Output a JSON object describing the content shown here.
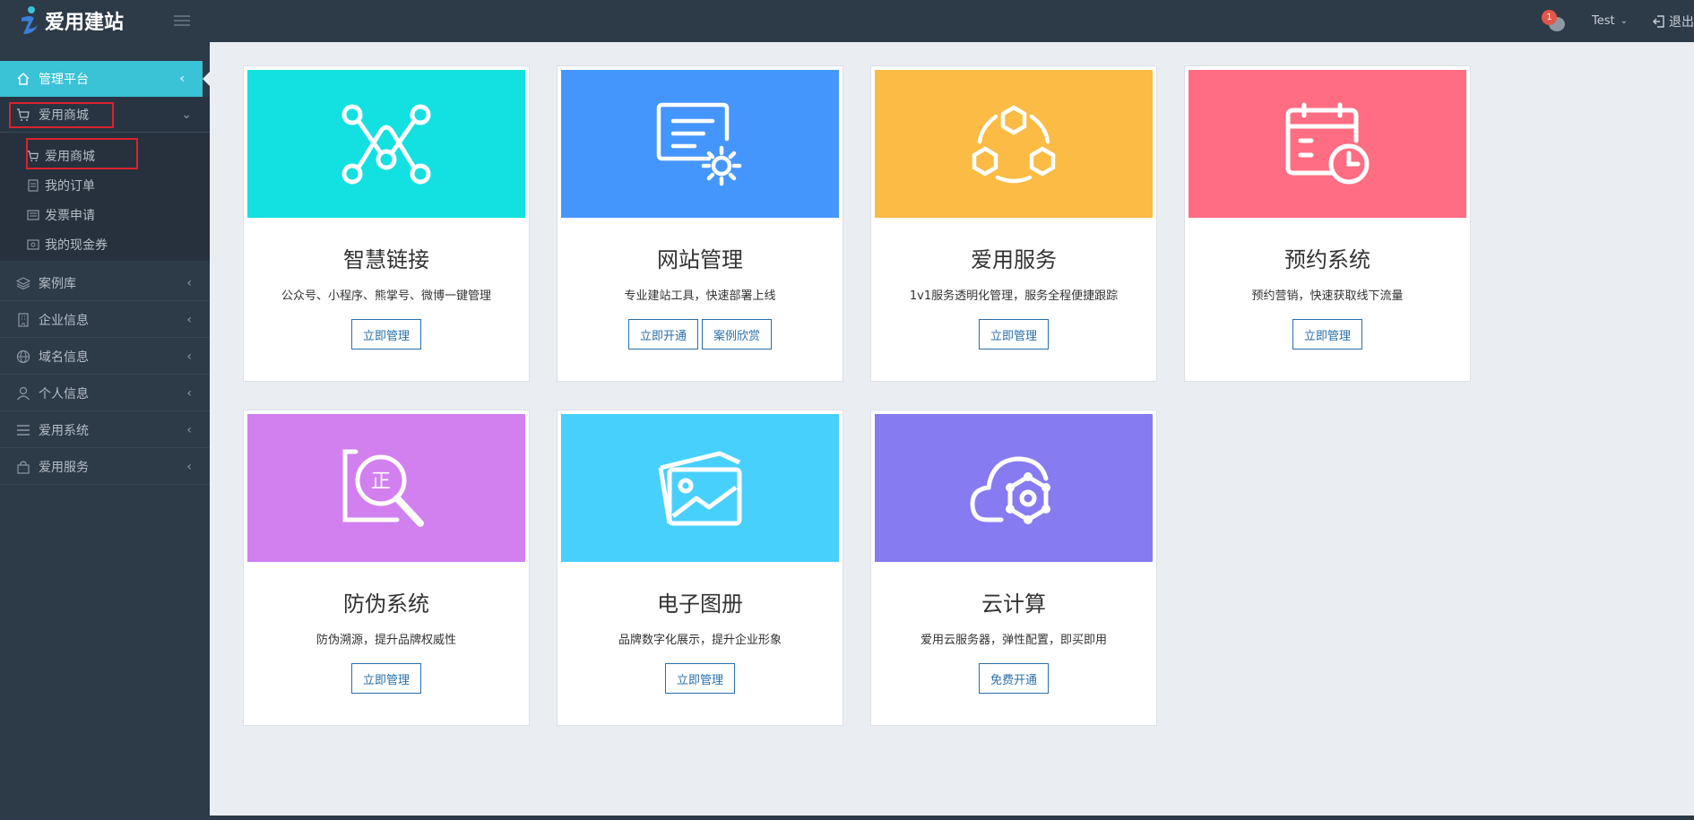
{
  "header": {
    "logo_text": "爱用建站",
    "notification_count": "1",
    "user_name": "Test",
    "logout_label": "退出"
  },
  "sidebar": {
    "active": {
      "label": "管理平台"
    },
    "items": [
      {
        "label": "爱用商城",
        "icon": "cart-icon"
      },
      {
        "label": "案例库",
        "icon": "layers-icon"
      },
      {
        "label": "企业信息",
        "icon": "building-icon"
      },
      {
        "label": "域名信息",
        "icon": "globe-icon"
      },
      {
        "label": "个人信息",
        "icon": "user-icon"
      },
      {
        "label": "爱用系统",
        "icon": "list-icon"
      },
      {
        "label": "爱用服务",
        "icon": "bag-icon"
      }
    ],
    "sub_items": [
      {
        "label": "爱用商城",
        "icon": "cart-icon"
      },
      {
        "label": "我的订单",
        "icon": "document-icon"
      },
      {
        "label": "发票申请",
        "icon": "invoice-icon"
      },
      {
        "label": "我的现金券",
        "icon": "coupon-icon"
      }
    ]
  },
  "cards": [
    {
      "title": "智慧链接",
      "desc": "公众号、小程序、熊掌号、微博一键管理",
      "color": "#13e1e1",
      "icon": "network-icon",
      "buttons": [
        "立即管理"
      ]
    },
    {
      "title": "网站管理",
      "desc": "专业建站工具，快速部署上线",
      "color": "#4596fc",
      "icon": "certificate-gear-icon",
      "buttons": [
        "立即开通",
        "案例欣赏"
      ]
    },
    {
      "title": "爱用服务",
      "desc": "1v1服务透明化管理，服务全程便捷跟踪",
      "color": "#fbbb44",
      "icon": "hexagon-cycle-icon",
      "buttons": [
        "立即管理"
      ]
    },
    {
      "title": "预约系统",
      "desc": "预约营销，快速获取线下流量",
      "color": "#ff6d82",
      "icon": "calendar-clock-icon",
      "buttons": [
        "立即管理"
      ]
    },
    {
      "title": "防伪系统",
      "desc": "防伪溯源，提升品牌权威性",
      "color": "#d27ff0",
      "icon": "search-verify-icon",
      "buttons": [
        "立即管理"
      ]
    },
    {
      "title": "电子图册",
      "desc": "品牌数字化展示，提升企业形象",
      "color": "#48d0fd",
      "icon": "photo-album-icon",
      "buttons": [
        "立即管理"
      ]
    },
    {
      "title": "云计算",
      "desc": "爱用云服务器，弹性配置，即买即用",
      "color": "#867bf1",
      "icon": "cloud-gear-icon",
      "buttons": [
        "免费开通"
      ]
    }
  ],
  "card_glyphs": {
    "verify_char": "正"
  }
}
